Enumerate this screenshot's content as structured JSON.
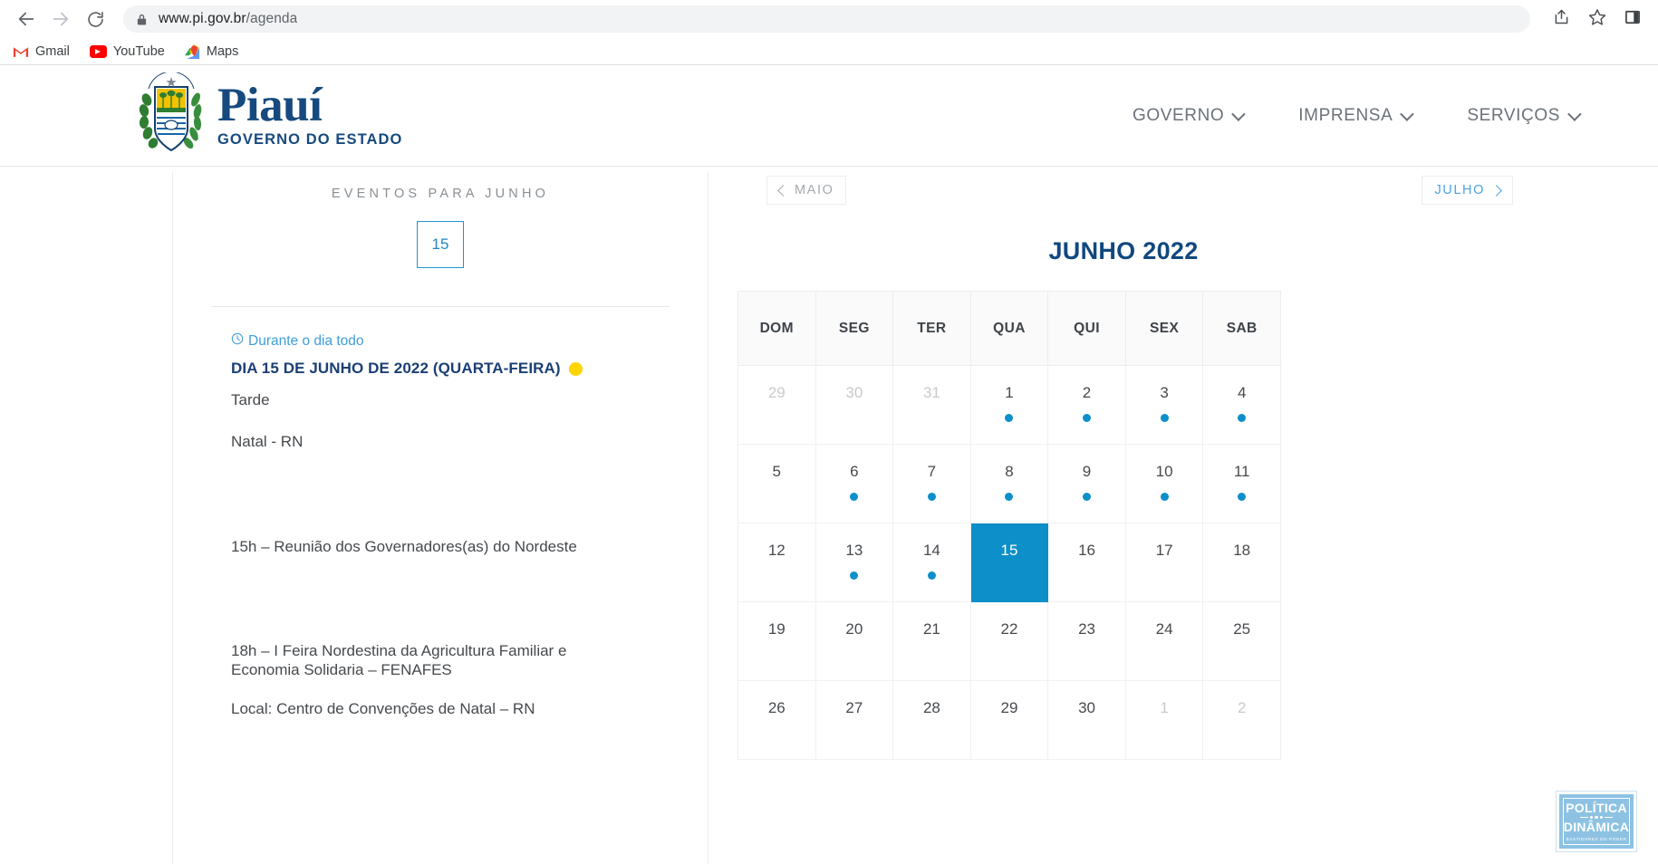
{
  "browser": {
    "back_icon": "back-arrow-icon",
    "forward_icon": "forward-arrow-icon",
    "reload_icon": "reload-icon",
    "lock_icon": "lock-icon",
    "url_domain": "www.pi.gov.br",
    "url_path": "/agenda",
    "share_icon": "share-icon",
    "bookmark_icon": "star-icon",
    "sidepanel_icon": "side-panel-icon",
    "bookmarks": [
      {
        "label": "Gmail",
        "icon": "gmail-icon"
      },
      {
        "label": "YouTube",
        "icon": "youtube-icon"
      },
      {
        "label": "Maps",
        "icon": "google-maps-icon"
      }
    ]
  },
  "site_header": {
    "brand_name": "Piauí",
    "brand_subtitle": "GOVERNO DO ESTADO",
    "crest_alt": "brasao-do-piaui",
    "nav": [
      {
        "label": "GOVERNO"
      },
      {
        "label": "IMPRENSA"
      },
      {
        "label": "SERVIÇOS"
      }
    ]
  },
  "events_panel": {
    "heading": "EVENTOS PARA JUNHO",
    "selected_day": "15",
    "all_day_label": "Durante o dia todo",
    "clock_icon": "clock-icon",
    "event_title": "DIA 15 DE JUNHO DE 2022 (QUARTA-FEIRA)",
    "event_badge_color": "#ffd500",
    "lines": {
      "period": "Tarde",
      "location_city": "Natal - RN",
      "item_15h": "15h – Reunião dos Governadores(as) do Nordeste",
      "item_18h": "18h – I Feira Nordestina da Agricultura Familiar e Economia Solidaria – FENAFES",
      "item_local": "Local: Centro de Convenções de Natal – RN"
    }
  },
  "calendar": {
    "prev_label": "MAIO",
    "next_label": "JULHO",
    "title": "JUNHO 2022",
    "weekday_headers": [
      "DOM",
      "SEG",
      "TER",
      "QUA",
      "QUI",
      "SEX",
      "SAB"
    ],
    "accent_color": "#0d8fc9",
    "weeks": [
      [
        {
          "day": "29",
          "muted": true,
          "dot": false,
          "selected": false
        },
        {
          "day": "30",
          "muted": true,
          "dot": false,
          "selected": false
        },
        {
          "day": "31",
          "muted": true,
          "dot": false,
          "selected": false
        },
        {
          "day": "1",
          "muted": false,
          "dot": true,
          "selected": false
        },
        {
          "day": "2",
          "muted": false,
          "dot": true,
          "selected": false
        },
        {
          "day": "3",
          "muted": false,
          "dot": true,
          "selected": false
        },
        {
          "day": "4",
          "muted": false,
          "dot": true,
          "selected": false
        }
      ],
      [
        {
          "day": "5",
          "muted": false,
          "dot": false,
          "selected": false
        },
        {
          "day": "6",
          "muted": false,
          "dot": true,
          "selected": false
        },
        {
          "day": "7",
          "muted": false,
          "dot": true,
          "selected": false
        },
        {
          "day": "8",
          "muted": false,
          "dot": true,
          "selected": false
        },
        {
          "day": "9",
          "muted": false,
          "dot": true,
          "selected": false
        },
        {
          "day": "10",
          "muted": false,
          "dot": true,
          "selected": false
        },
        {
          "day": "11",
          "muted": false,
          "dot": true,
          "selected": false
        }
      ],
      [
        {
          "day": "12",
          "muted": false,
          "dot": false,
          "selected": false
        },
        {
          "day": "13",
          "muted": false,
          "dot": true,
          "selected": false
        },
        {
          "day": "14",
          "muted": false,
          "dot": true,
          "selected": false
        },
        {
          "day": "15",
          "muted": false,
          "dot": false,
          "selected": true
        },
        {
          "day": "16",
          "muted": false,
          "dot": false,
          "selected": false
        },
        {
          "day": "17",
          "muted": false,
          "dot": false,
          "selected": false
        },
        {
          "day": "18",
          "muted": false,
          "dot": false,
          "selected": false
        }
      ],
      [
        {
          "day": "19",
          "muted": false,
          "dot": false,
          "selected": false
        },
        {
          "day": "20",
          "muted": false,
          "dot": false,
          "selected": false
        },
        {
          "day": "21",
          "muted": false,
          "dot": false,
          "selected": false
        },
        {
          "day": "22",
          "muted": false,
          "dot": false,
          "selected": false
        },
        {
          "day": "23",
          "muted": false,
          "dot": false,
          "selected": false
        },
        {
          "day": "24",
          "muted": false,
          "dot": false,
          "selected": false
        },
        {
          "day": "25",
          "muted": false,
          "dot": false,
          "selected": false
        }
      ],
      [
        {
          "day": "26",
          "muted": false,
          "dot": false,
          "selected": false
        },
        {
          "day": "27",
          "muted": false,
          "dot": false,
          "selected": false
        },
        {
          "day": "28",
          "muted": false,
          "dot": false,
          "selected": false
        },
        {
          "day": "29",
          "muted": false,
          "dot": false,
          "selected": false
        },
        {
          "day": "30",
          "muted": false,
          "dot": false,
          "selected": false
        },
        {
          "day": "1",
          "muted": true,
          "dot": false,
          "selected": false
        },
        {
          "day": "2",
          "muted": true,
          "dot": false,
          "selected": false
        }
      ]
    ]
  },
  "watermark": {
    "line1": "POLÍTICA",
    "line2": "DINÂMICA",
    "line3": "BASTIDORES DO PODER"
  }
}
